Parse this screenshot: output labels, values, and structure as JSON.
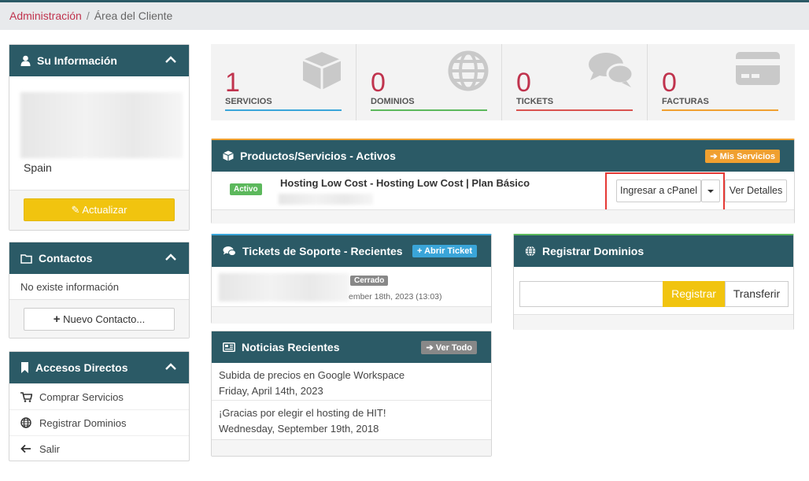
{
  "breadcrumb": {
    "home": "Administración",
    "separator": "/",
    "current": "Área del Cliente"
  },
  "info_panel": {
    "title": "Su Información",
    "country": "Spain",
    "update_button": "Actualizar"
  },
  "contacts_panel": {
    "title": "Contactos",
    "empty_text": "No existe información",
    "new_contact_button": "Nuevo Contacto..."
  },
  "shortcuts_panel": {
    "title": "Accesos Directos",
    "items": [
      {
        "label": "Comprar Servicios",
        "icon": "cart-icon"
      },
      {
        "label": "Registrar Dominios",
        "icon": "globe-icon"
      },
      {
        "label": "Salir",
        "icon": "arrow-left-icon"
      }
    ]
  },
  "stats": [
    {
      "value": "1",
      "label": "SERVICIOS",
      "color": "#3aa5d9",
      "icon": "cube-icon"
    },
    {
      "value": "0",
      "label": "DOMINIOS",
      "color": "#5cb85c",
      "icon": "globe-icon"
    },
    {
      "value": "0",
      "label": "TICKETS",
      "color": "#d9534f",
      "icon": "chat-icon"
    },
    {
      "value": "0",
      "label": "FACTURAS",
      "color": "#f0a030",
      "icon": "credit-card-icon"
    }
  ],
  "products_panel": {
    "title": "Productos/Servicios - Activos",
    "my_services_button": "Mis Servicios",
    "service": {
      "status": "Activo",
      "name": "Hosting Low Cost - Hosting Low Cost | Plan Básico",
      "cpanel_button": "Ingresar a cPanel",
      "details_button": "Ver Detalles"
    }
  },
  "tickets_panel": {
    "title": "Tickets de Soporte - Recientes",
    "open_ticket_button": "Abrir Ticket",
    "ticket": {
      "status": "Cerrado",
      "date": "ember 18th, 2023 (13:03)"
    }
  },
  "domains_panel": {
    "title": "Registrar Dominios",
    "register_button": "Registrar",
    "transfer_button": "Transferir"
  },
  "news_panel": {
    "title": "Noticias Recientes",
    "view_all_button": "Ver Todo",
    "items": [
      {
        "headline": "Subida de precios en Google Workspace",
        "date": "Friday, April 14th, 2023"
      },
      {
        "headline": "¡Gracias por elegir el hosting de HIT!",
        "date": "Wednesday, September 19th, 2018"
      }
    ]
  },
  "colors": {
    "header": "#2b5a66",
    "accent_red": "#c0334d",
    "yellow": "#f1c40f",
    "highlight_box": "#e53935"
  }
}
